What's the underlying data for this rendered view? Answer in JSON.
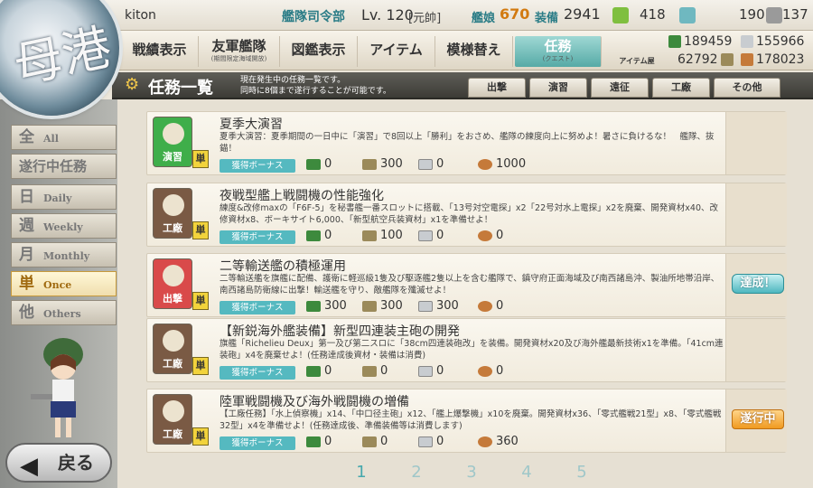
{
  "header": {
    "username": "kiton",
    "hq_label": "艦隊司令部",
    "level": "Lv. 120",
    "rank": "[元帥]",
    "ships_label": "艦娘",
    "ships_value": "670",
    "equip_label": "装備",
    "equip_value": "2941",
    "bucket": "418",
    "devmat": "190",
    "screw": "137"
  },
  "menu": {
    "record": "戦績表示",
    "friend": "友軍艦隊",
    "friend_sub": "(期間限定海域開放)",
    "album": "図鑑表示",
    "item": "アイテム",
    "remodel": "模様替え",
    "quest": "任務",
    "quest_sub": "(クエスト)",
    "akashi": "アイテム屋"
  },
  "resources": {
    "fuel": "189459",
    "steel": "155966",
    "ammo": "62792",
    "baux": "178023"
  },
  "titlebar": {
    "title": "任務一覧",
    "desc1": "現在発生中の任務一覧です。",
    "desc2": "同時に8個まで遂行することが可能です。"
  },
  "filter_tabs": [
    "出撃",
    "演習",
    "遠征",
    "工廠",
    "その他"
  ],
  "categories": [
    {
      "kanji": "全",
      "label": "All"
    },
    {
      "kanji": "遂行中任務",
      "label": ""
    },
    {
      "kanji": "日",
      "label": "Daily"
    },
    {
      "kanji": "週",
      "label": "Weekly"
    },
    {
      "kanji": "月",
      "label": "Monthly"
    },
    {
      "kanji": "単",
      "label": "Once"
    },
    {
      "kanji": "他",
      "label": "Others"
    }
  ],
  "back_label": "戻る",
  "once_badge": "単",
  "bonus_label": "獲得ボーナス",
  "quests": [
    {
      "type": "演習",
      "title": "夏季大演習",
      "desc": "夏季大演習：夏季期間の一日中に「演習」で8回以上「勝利」をおさめ、艦隊の練度向上に努めよ！暑さに負けるな！　艦隊、抜錨！",
      "fuel": "0",
      "ammo": "300",
      "steel": "0",
      "baux": "1000",
      "status": "",
      "color": "#3fae4a"
    },
    {
      "type": "工廠",
      "title": "夜戦型艦上戦闘機の性能強化",
      "desc": "練度&改修maxの「F6F-5」を秘書艦一番スロットに搭載、「13号対空電探」x2「22号対水上電探」x2を廃棄、開発資材x40、改修資材x8、ボーキサイト6,000、「新型航空兵装資材」x1を準備せよ！",
      "fuel": "0",
      "ammo": "100",
      "steel": "0",
      "baux": "0",
      "status": "",
      "color": "#7a5a44"
    },
    {
      "type": "出撃",
      "title": "二等輸送艦の積極運用",
      "desc": "二等輸送艦を旗艦に配備、護衛に軽巡級1隻及び駆逐艦2隻以上を含む艦隊で、鎮守府正面海域及び南西諸島沖、製油所地帯沿岸、南西諸島防衛線に出撃！輸送艦を守り、敵艦隊を殲滅せよ！",
      "fuel": "300",
      "ammo": "300",
      "steel": "300",
      "baux": "0",
      "status": "達成！",
      "color": "#d94a4a"
    },
    {
      "type": "工廠",
      "title": "【新鋭海外艦装備】新型四連装主砲の開発",
      "desc": "旗艦「Richelieu Deux」第一及び第二スロに「38cm四連装砲改」を装備。開発資材x20及び海外艦最新技術x1を準備。「41cm連装砲」x4を廃棄せよ！(任務達成後資材・装備は消費)",
      "fuel": "0",
      "ammo": "0",
      "steel": "0",
      "baux": "0",
      "status": "",
      "color": "#7a5a44"
    },
    {
      "type": "工廠",
      "title": "陸軍戦闘機及び海外戦闘機の増備",
      "desc": "【工廠任務】「水上偵察機」x14、「中口径主砲」x12、「艦上爆撃機」x10を廃棄。開発資材x36、「零式艦戦21型」x8、「零式艦戦32型」x4を準備せよ！(任務達成後、準備装備等は消費します)",
      "fuel": "0",
      "ammo": "0",
      "steel": "0",
      "baux": "360",
      "status": "遂行中",
      "color": "#7a5a44"
    }
  ],
  "pages": [
    "1",
    "2",
    "3",
    "4",
    "5"
  ]
}
